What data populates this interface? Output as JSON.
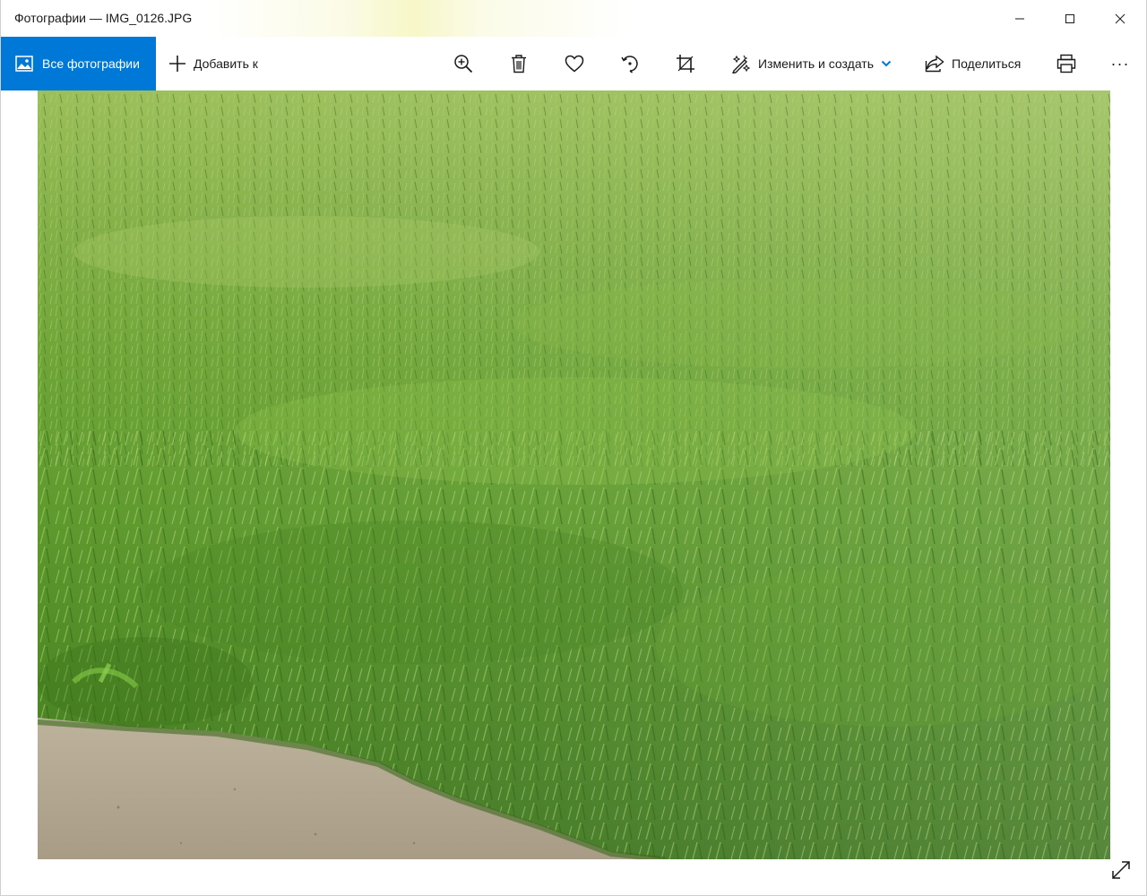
{
  "window": {
    "title": "Фотографии — IMG_0126.JPG"
  },
  "toolbar": {
    "all_photos_label": "Все фотографии",
    "add_to_label": "Добавить к",
    "edit_create_label": "Изменить и создать",
    "share_label": "Поделиться",
    "more_label": "···"
  },
  "icons": {
    "all_photos": "photo-icon",
    "add": "plus-icon",
    "zoom": "zoom-in-icon",
    "delete": "trash-icon",
    "favorite": "heart-icon",
    "rotate": "rotate-icon",
    "crop": "crop-icon",
    "edit": "edit-create-icon",
    "dropdown": "chevron-down-icon",
    "share": "share-icon",
    "print": "print-icon",
    "fullscreen": "fullscreen-icon",
    "minimize": "minimize-icon",
    "maximize": "maximize-icon",
    "close": "close-icon"
  },
  "colors": {
    "accent": "#0078d7",
    "toolbar_bg": "#ffffff",
    "text": "#1a1a1a"
  }
}
